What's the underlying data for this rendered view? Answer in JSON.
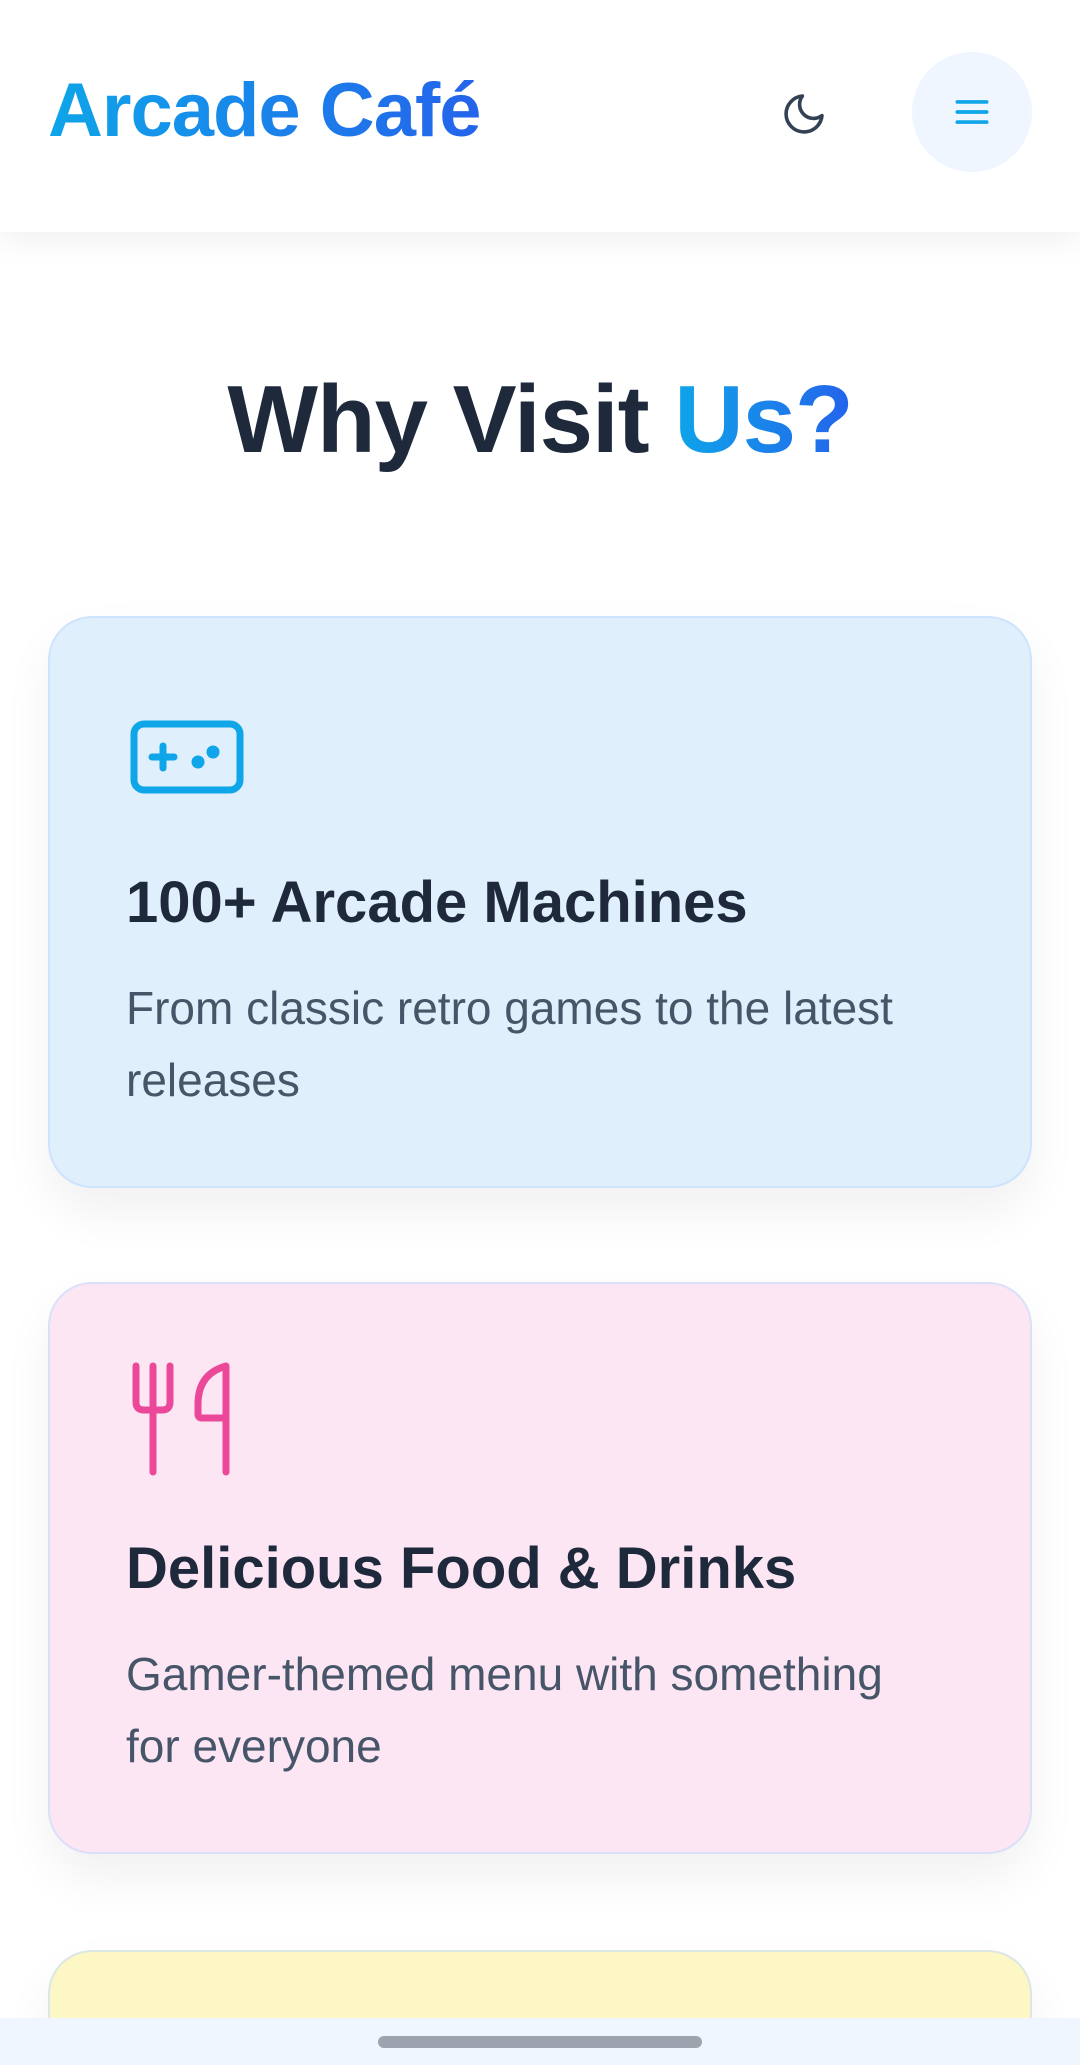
{
  "header": {
    "brand": "Arcade Café",
    "icons": {
      "theme_toggle": "moon-icon",
      "menu": "hamburger-menu-icon"
    }
  },
  "section": {
    "title_main": "Why Visit",
    "title_accent": "Us?"
  },
  "features": [
    {
      "icon": "gamepad-icon",
      "icon_color": "#0ea5e9",
      "background": "#dfeffc",
      "title": "100+ Arcade Machines",
      "text": "From classic retro games to the latest releases"
    },
    {
      "icon": "fork-knife-icon",
      "icon_color": "#ec4899",
      "background": "#fce6f3",
      "title": "Delicious Food & Drinks",
      "text": "Gamer-themed menu with something for everyone"
    },
    {
      "background": "#fdf6c5"
    }
  ],
  "colors": {
    "brand_start": "#0ea5e9",
    "brand_end": "#2563eb",
    "heading": "#1e293b",
    "body_text": "#475569"
  }
}
